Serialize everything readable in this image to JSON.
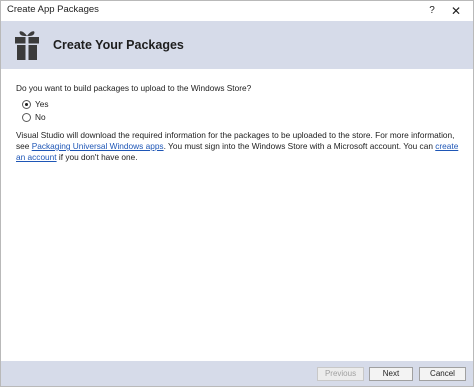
{
  "window": {
    "title": "Create App Packages",
    "help_label": "?",
    "close_label": "✕"
  },
  "header": {
    "title": "Create Your Packages",
    "icon": "gift-package-icon",
    "background": "#d6dbe9"
  },
  "main": {
    "question": "Do you want to build packages to upload to the Windows Store?",
    "options": [
      {
        "label": "Yes",
        "selected": true
      },
      {
        "label": "No",
        "selected": false
      }
    ],
    "info": {
      "text_1": "Visual Studio will download the required information for the packages to be uploaded to the store. For more information, see ",
      "link_1": "Packaging Universal Windows apps",
      "text_2": ". You must sign into the Windows Store with a Microsoft account. You can ",
      "link_2": "create an account",
      "text_3": " if you don't have one."
    },
    "link_color": "#1e56b6"
  },
  "footer": {
    "previous_label": "Previous",
    "next_label": "Next",
    "cancel_label": "Cancel"
  }
}
